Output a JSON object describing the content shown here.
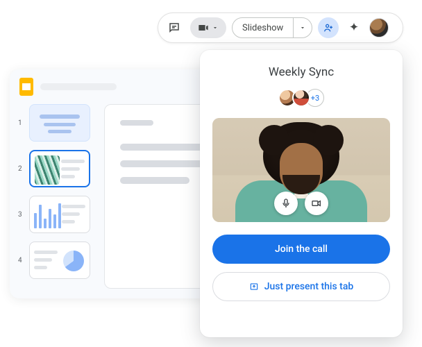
{
  "toolbar": {
    "slideshow_label": "Slideshow"
  },
  "editor": {
    "thumbs": [
      {
        "num": "1"
      },
      {
        "num": "2"
      },
      {
        "num": "3"
      },
      {
        "num": "4"
      }
    ],
    "selected_index": 1
  },
  "meet": {
    "title": "Weekly Sync",
    "more_count_label": "+3",
    "join_label": "Join the call",
    "present_label": "Just present this tab"
  }
}
